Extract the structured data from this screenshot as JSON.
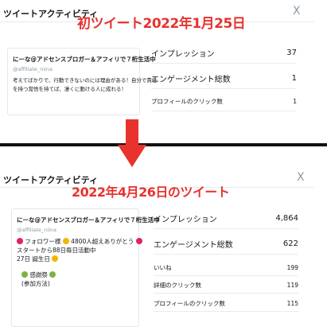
{
  "top": {
    "panel_title": "ツイートアクティビティ",
    "close_label": "X",
    "overlay": "初ツイート2022年1月25日",
    "tweet": {
      "name": "にーな@アドセンスブロガー＆アフィリで７桁生活中",
      "handle": "@affiliate_niina",
      "line1": "考えてばかりで、行動できないのには理由がある！自分で責任",
      "line2": "を持つ覚悟を持てば、凄くに動ける人に成れる！"
    },
    "metrics": [
      {
        "label": "インプレッション",
        "value": "37"
      },
      {
        "label": "エンゲージメント総数",
        "value": "1"
      },
      {
        "label": "プロフィールのクリック数",
        "value": "1"
      }
    ]
  },
  "bottom": {
    "panel_title": "ツイートアクティビティ",
    "close_label": "X",
    "overlay": "2022年4月26日のツイート",
    "tweet": {
      "name": "にーな@アドセンスブロガー＆アフィリで７桁生活中",
      "handle": "@affiliate_niina",
      "line1": "フォロワー様",
      "line1b": "4800人超えありがとう",
      "line2": "スタートから88日毎日活動中",
      "line3": "27日 誕生日",
      "line4": "感謝祭",
      "line5": "(参加方法)"
    },
    "metrics": [
      {
        "label": "インプレッション",
        "value": "4,864"
      },
      {
        "label": "エンゲージメント総数",
        "value": "622"
      },
      {
        "label": "いいね",
        "value": "199"
      },
      {
        "label": "詳細のクリック数",
        "value": "119"
      },
      {
        "label": "プロフィールのクリック数",
        "value": "115"
      }
    ]
  },
  "colors": {
    "overlay_red": "#e8322e",
    "divider": "#111111",
    "heart_red": "#e0245e",
    "emoji_yellow": "#f5b400",
    "emoji_green": "#7cb342"
  },
  "icons": {
    "close": "close-icon",
    "arrow": "down-arrow-icon",
    "heart": "heart-emoji-icon",
    "face": "smiley-emoji-icon"
  }
}
